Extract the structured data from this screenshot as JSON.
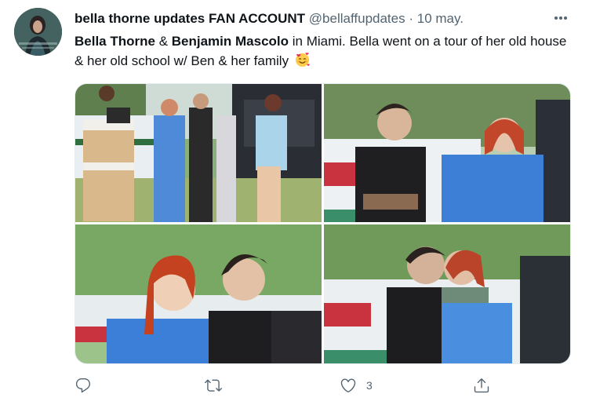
{
  "tweet": {
    "author": {
      "display_name": "bella thorne updates FAN ACCOUNT",
      "handle": "@bellaffupdates",
      "separator": "·",
      "date": "10 may."
    },
    "text": {
      "part1": "Bella Thorne",
      "part2": " & ",
      "part3": "Benjamin Mascolo",
      "part4": " in Miami. Bella went on a tour of her old house & her old school w/ Ben & her family "
    },
    "media": [
      {
        "name": "photo-1",
        "icon": "photo"
      },
      {
        "name": "photo-2",
        "icon": "photo"
      },
      {
        "name": "photo-3",
        "icon": "photo"
      },
      {
        "name": "photo-4",
        "icon": "photo"
      }
    ],
    "actions": {
      "reply": {
        "icon": "reply-icon",
        "count": ""
      },
      "retweet": {
        "icon": "retweet-icon",
        "count": ""
      },
      "like": {
        "icon": "heart-icon",
        "count": "3"
      },
      "share": {
        "icon": "share-icon",
        "count": ""
      }
    },
    "colors": {
      "text": "#0f1419",
      "secondary": "#536471",
      "border": "#e6ecf0"
    }
  }
}
